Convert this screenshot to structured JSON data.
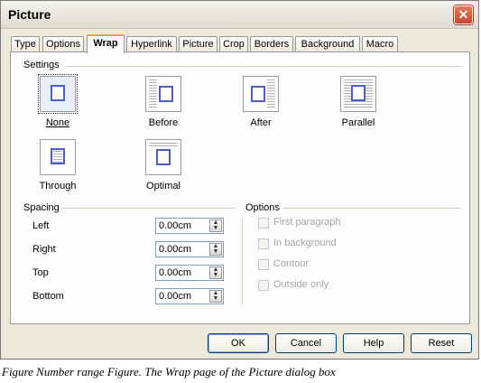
{
  "window": {
    "title": "Picture",
    "close_glyph": "✕"
  },
  "tabs": [
    {
      "label": "Type"
    },
    {
      "label": "Options"
    },
    {
      "label": "Wrap"
    },
    {
      "label": "Hyperlink"
    },
    {
      "label": "Picture"
    },
    {
      "label": "Crop"
    },
    {
      "label": "Borders"
    },
    {
      "label": "Background"
    },
    {
      "label": "Macro"
    }
  ],
  "active_tab": "Wrap",
  "settings": {
    "title": "Settings",
    "selected": "None",
    "options": [
      {
        "label": "None",
        "icon": "wrap-none-icon"
      },
      {
        "label": "Before",
        "icon": "wrap-before-icon"
      },
      {
        "label": "After",
        "icon": "wrap-after-icon"
      },
      {
        "label": "Parallel",
        "icon": "wrap-parallel-icon"
      },
      {
        "label": "Through",
        "icon": "wrap-through-icon"
      },
      {
        "label": "Optimal",
        "icon": "wrap-optimal-icon"
      }
    ]
  },
  "spacing": {
    "title": "Spacing",
    "rows": [
      {
        "label": "Left",
        "value": "0.00cm"
      },
      {
        "label": "Right",
        "value": "0.00cm"
      },
      {
        "label": "Top",
        "value": "0.00cm"
      },
      {
        "label": "Bottom",
        "value": "0.00cm"
      }
    ]
  },
  "options": {
    "title": "Options",
    "items": [
      {
        "label": "First paragraph",
        "checked": false,
        "enabled": false
      },
      {
        "label": "In background",
        "checked": false,
        "enabled": false
      },
      {
        "label": "Contour",
        "checked": false,
        "enabled": false
      },
      {
        "label": "Outside only",
        "checked": false,
        "enabled": false
      }
    ]
  },
  "buttons": {
    "ok": "OK",
    "cancel": "Cancel",
    "help": "Help",
    "reset": "Reset"
  },
  "caption": "Figure Number range Figure. The Wrap page of the Picture dialog box",
  "colors": {
    "accent": "#f1a63c",
    "frame": "#4a5ecf",
    "close": "#c8442a"
  }
}
